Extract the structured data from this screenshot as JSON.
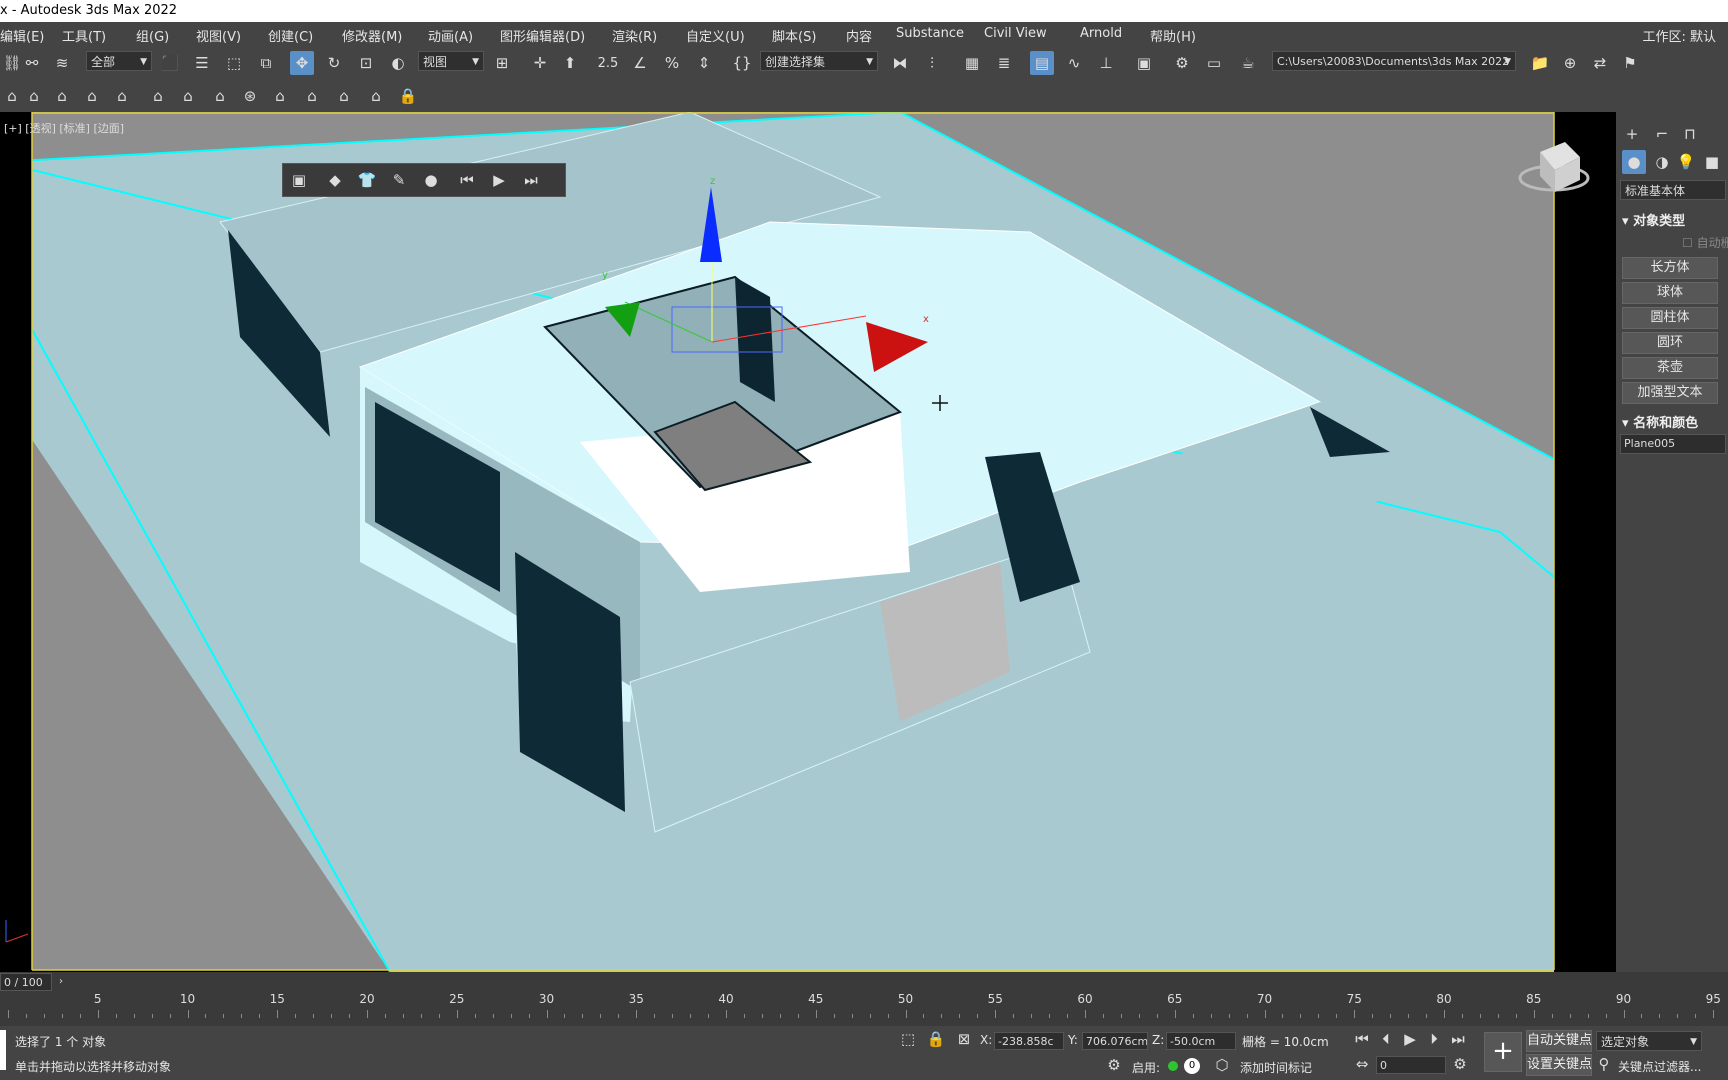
{
  "window": {
    "title": "x - Autodesk 3ds Max 2022"
  },
  "menu": {
    "items": [
      "编辑(E)",
      "工具(T)",
      "组(G)",
      "视图(V)",
      "创建(C)",
      "修改器(M)",
      "动画(A)",
      "图形编辑器(D)",
      "渲染(R)",
      "自定义(U)",
      "脚本(S)",
      "内容",
      "Substance",
      "Civil View",
      "Arnold",
      "帮助(H)"
    ],
    "workspace": "工作区: 默认"
  },
  "toolbar": {
    "filter_value": "全部",
    "refcoord_value": "视图",
    "selection_set_placeholder": "创建选择集",
    "project_path": "C:\\Users\\20083\\Documents\\3ds Max 2022",
    "snap_label": "2.5"
  },
  "viewport": {
    "label": "[+] [透视] [标准] [边面]",
    "gizmo_axes": {
      "x": "x",
      "y": "y",
      "z": "z"
    }
  },
  "command_panel": {
    "category": "标准基本体",
    "object_type_title": "对象类型",
    "autogrid_label": "自动栅格",
    "buttons": [
      "长方体",
      "球体",
      "圆柱体",
      "圆环",
      "茶壶",
      "加强型文本"
    ],
    "name_color_title": "名称和颜色",
    "object_name": "Plane005"
  },
  "timeline": {
    "frame_display": "0 / 100",
    "ticks": [
      "5",
      "10",
      "15",
      "20",
      "25",
      "30",
      "35",
      "40",
      "45",
      "50",
      "55",
      "60",
      "65",
      "70",
      "75",
      "80",
      "85",
      "90",
      "95"
    ]
  },
  "status": {
    "selection_text": "选择了 1 个 对象",
    "prompt_text": "单击并拖动以选择并移动对象",
    "x_label": "X:",
    "x_value": "-238.858c",
    "y_label": "Y:",
    "y_value": "706.076cm",
    "z_label": "Z:",
    "z_value": "-50.0cm",
    "grid_text": "栅格 = 10.0cm",
    "enable_label": "启用:",
    "add_time_tag": "添加时间标记",
    "auto_key": "自动关键点",
    "set_key": "设置关键点",
    "selected_object": "选定对象",
    "key_filter": "关键点过滤器...",
    "current_frame": "0"
  },
  "colors": {
    "viewport_bg": "#000000",
    "ground": "#8e8e8e",
    "model_light": "#d4f7fb",
    "model_mid": "#a8c8d0",
    "selection_edge": "#00ffff",
    "active_border": "#e0d23a"
  }
}
